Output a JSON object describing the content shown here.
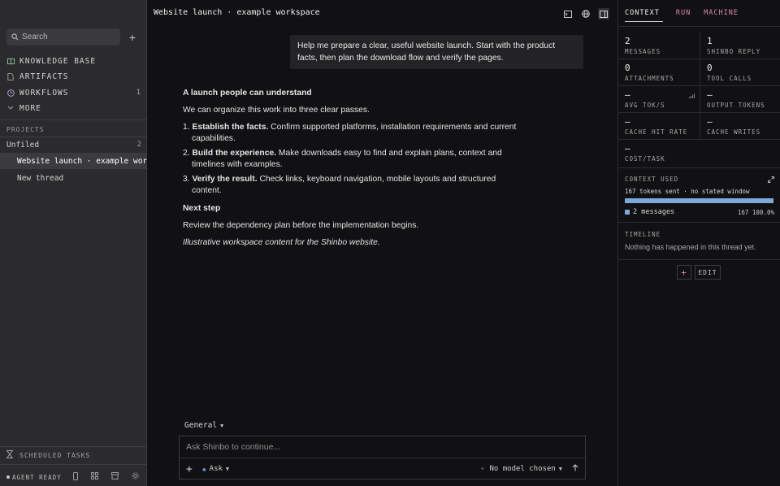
{
  "sidebar": {
    "search_placeholder": "Search",
    "nav": [
      {
        "label": "KNOWLEDGE BASE",
        "icon": "book-icon"
      },
      {
        "label": "ARTIFACTS",
        "icon": "file-icon"
      },
      {
        "label": "WORKFLOWS",
        "icon": "clock-icon",
        "count": "1"
      },
      {
        "label": "MORE",
        "icon": "chevron-down-icon"
      }
    ],
    "projects_label": "PROJECTS",
    "group": {
      "label": "Unfiled",
      "count": "2"
    },
    "threads": [
      {
        "label": "Website launch · example workspace",
        "active": true
      },
      {
        "label": "New thread",
        "active": false
      }
    ],
    "scheduled_label": "SCHEDULED TASKS",
    "status_label": "AGENT READY"
  },
  "main": {
    "title": "Website launch · example workspace",
    "user_message": "Help me prepare a clear, useful website launch. Start with the product facts, then plan the download flow and verify the pages.",
    "assistant": {
      "heading": "A launch people can understand",
      "intro": "We can organize this work into three clear passes.",
      "steps": [
        {
          "num": "1.",
          "bold": "Establish the facts.",
          "text": " Confirm supported platforms, installation requirements and current capabilities."
        },
        {
          "num": "2.",
          "bold": "Build the experience.",
          "text": " Make downloads easy to find and explain plans, context and timelines with examples."
        },
        {
          "num": "3.",
          "bold": "Verify the result.",
          "text": " Check links, keyboard navigation, mobile layouts and structured content."
        }
      ],
      "next_heading": "Next step",
      "next_text": "Review the dependency plan before the implementation begins.",
      "note": "Illustrative workspace content for the Shinbo website."
    },
    "composer": {
      "channel": "General",
      "placeholder": "Ask Shinbo to continue...",
      "mode": "Ask",
      "model": "No model chosen"
    }
  },
  "panel": {
    "tabs": [
      "CONTEXT",
      "RUN",
      "MACHINE"
    ],
    "stats": [
      [
        {
          "value": "2",
          "label": "MESSAGES"
        },
        {
          "value": "1",
          "label": "SHINBO REPLY"
        }
      ],
      [
        {
          "value": "0",
          "label": "ATTACHMENTS"
        },
        {
          "value": "0",
          "label": "TOOL CALLS"
        }
      ],
      [
        {
          "value": "—",
          "label": "AVG TOK/S"
        },
        {
          "value": "—",
          "label": "OUTPUT TOKENS"
        }
      ],
      [
        {
          "value": "—",
          "label": "CACHE HIT RATE"
        },
        {
          "value": "—",
          "label": "CACHE WRITES"
        }
      ],
      [
        {
          "value": "—",
          "label": "COST/TASK"
        }
      ]
    ],
    "context": {
      "label": "CONTEXT USED",
      "sent": "167 tokens sent · no stated window",
      "fill_fraction": 1.0,
      "legend_label": "2 messages",
      "legend_right": "167 100.0%"
    },
    "timeline": {
      "label": "TIMELINE",
      "empty": "Nothing has happened in this thread yet."
    },
    "edit_label": "EDIT",
    "accent_color": "#d98aa5",
    "bar_color": "#7ea9dc"
  }
}
